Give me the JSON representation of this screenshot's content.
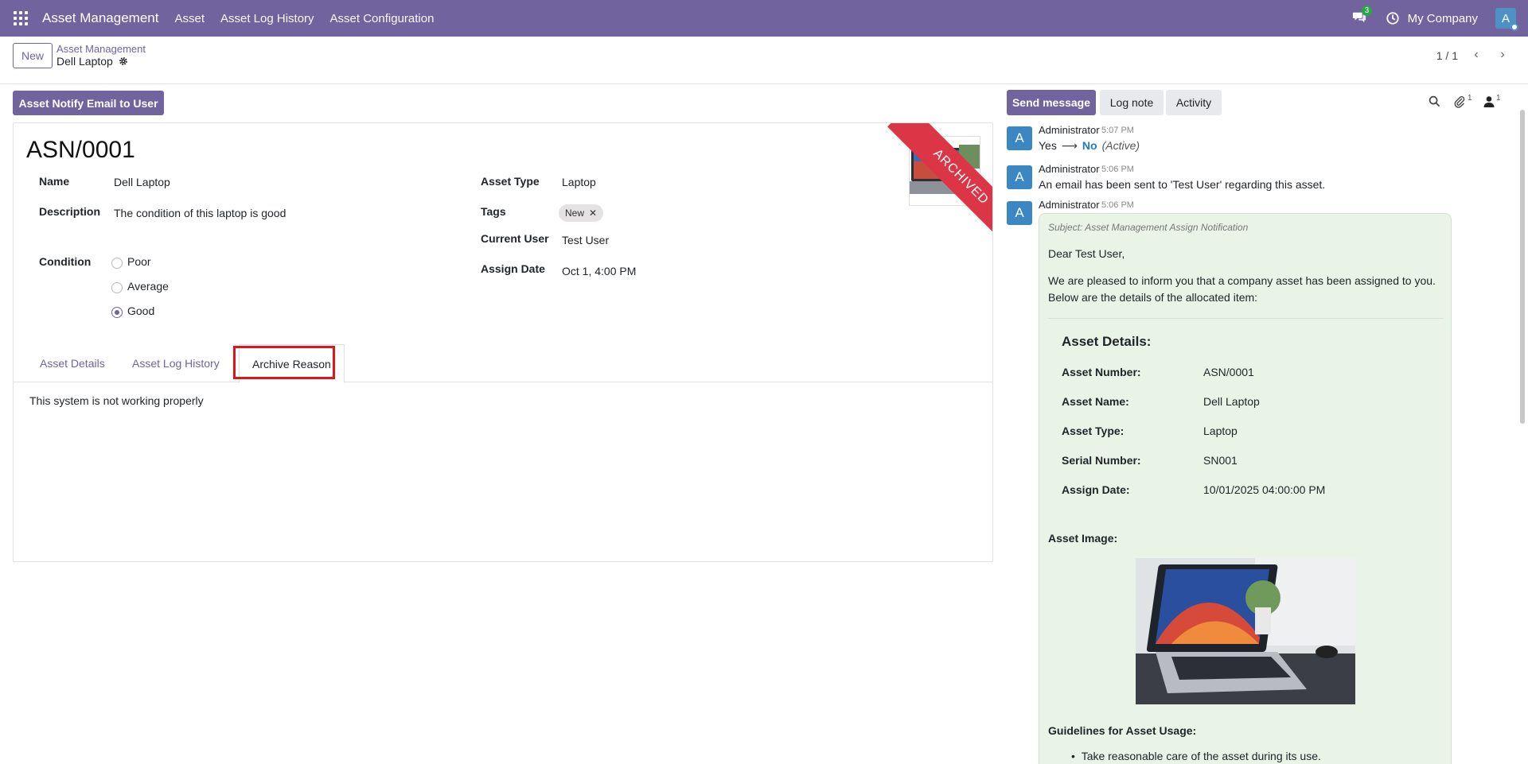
{
  "navbar": {
    "brand": "Asset Management",
    "menu": [
      "Asset",
      "Asset Log History",
      "Asset Configuration"
    ],
    "chat_badge": "3",
    "company": "My Company",
    "avatar_letter": "A"
  },
  "control": {
    "new_label": "New",
    "breadcrumb_parent": "Asset Management",
    "breadcrumb_current": "Dell Laptop",
    "pager": "1 / 1"
  },
  "form": {
    "notify_button": "Asset Notify Email to User",
    "record_title": "ASN/0001",
    "ribbon": "ARCHIVED",
    "name_label": "Name",
    "name_value": "Dell Laptop",
    "description_label": "Description",
    "description_value": "The condition of this laptop is good",
    "condition_label": "Condition",
    "condition_options": [
      "Poor",
      "Average",
      "Good"
    ],
    "condition_selected": "Good",
    "asset_type_label": "Asset Type",
    "asset_type_value": "Laptop",
    "tags_label": "Tags",
    "tag_value": "New",
    "current_user_label": "Current User",
    "current_user_value": "Test User",
    "assign_date_label": "Assign Date",
    "assign_date_value": "Oct 1, 4:00 PM",
    "tabs": [
      "Asset Details",
      "Asset Log History",
      "Archive Reason"
    ],
    "active_tab": "Archive Reason",
    "archive_reason": "This system is not working properly"
  },
  "chatter": {
    "send_message": "Send message",
    "log_note": "Log note",
    "activity": "Activity",
    "attachment_count": "1",
    "follower_count": "1",
    "messages": [
      {
        "avatar": "A",
        "author": "Administrator",
        "time": "5:07 PM",
        "old_value": "Yes",
        "new_value": "No",
        "field": "(Active)"
      },
      {
        "avatar": "A",
        "author": "Administrator",
        "time": "5:06 PM",
        "body": "An email has been sent to 'Test User' regarding this asset."
      },
      {
        "avatar": "A",
        "author": "Administrator",
        "time": "5:06 PM"
      }
    ],
    "mail": {
      "subject": "Subject: Asset Management Assign Notification",
      "greeting": "Dear Test User,",
      "intro_line1": "We are pleased to inform you that a company asset has been assigned to you.",
      "intro_line2": "Below are the details of the allocated item:",
      "details_title": "Asset Details:",
      "details": [
        {
          "label": "Asset Number:",
          "value": "ASN/0001"
        },
        {
          "label": "Asset Name:",
          "value": "Dell Laptop"
        },
        {
          "label": "Asset Type:",
          "value": "Laptop"
        },
        {
          "label": "Serial Number:",
          "value": "SN001"
        },
        {
          "label": "Assign Date:",
          "value": "10/01/2025 04:00:00 PM"
        }
      ],
      "image_title": "Asset Image:",
      "guidelines_title": "Guidelines for Asset Usage:",
      "guidelines": [
        "Take reasonable care of the asset during its use."
      ]
    }
  },
  "colors": {
    "brand": "#71639e",
    "archived_ribbon": "#dc3545",
    "mail_background": "#e9f4e6",
    "highlight_box": "#e0141e"
  }
}
